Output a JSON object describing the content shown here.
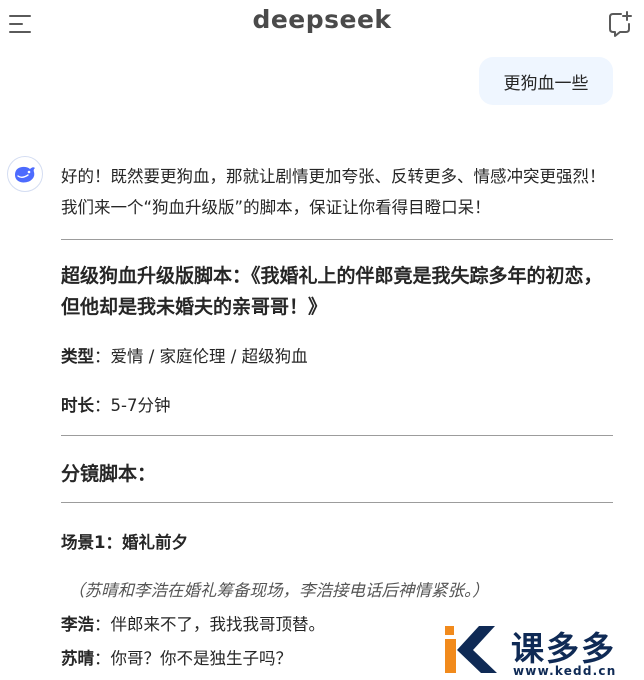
{
  "header": {
    "brand": "deepseek",
    "menu_icon": "hamburger-menu-icon",
    "new_chat_icon": "new-chat-icon"
  },
  "user_message": "更狗血一些",
  "assistant": {
    "avatar_icon": "deepseek-whale-icon",
    "intro": "好的！既然要更狗血，那就让剧情更加夸张、反转更多、情感冲突更强烈！我们来一个“狗血升级版”的脚本，保证让你看得目瞪口呆！",
    "script_title": "超级狗血升级版脚本：《我婚礼上的伴郎竟是我失踪多年的初恋，但他却是我未婚夫的亲哥哥！》",
    "type_label": "类型",
    "type_value": "：爱情 / 家庭伦理 / 超级狗血",
    "duration_label": "时长",
    "duration_value": "：5-7分钟",
    "storyboard_heading": "分镜脚本：",
    "scene_heading": "场景1：婚礼前夕",
    "stage_direction": "（苏晴和李浩在婚礼筹备现场，李浩接电话后神情紧张。）",
    "dialogue": [
      {
        "speaker": "李浩",
        "text": "：伴郎来不了，我找我哥顶替。"
      },
      {
        "speaker": "苏晴",
        "text": "：你哥？你不是独生子吗？"
      }
    ]
  },
  "watermark": {
    "text": "课多多",
    "url": "www.kedd.cn"
  },
  "colors": {
    "accent": "#4d6bfe",
    "user_bubble": "#eff6ff",
    "divider": "#9c9c9c",
    "watermark_orange": "#f18a1c",
    "watermark_navy": "#0f2a55"
  }
}
